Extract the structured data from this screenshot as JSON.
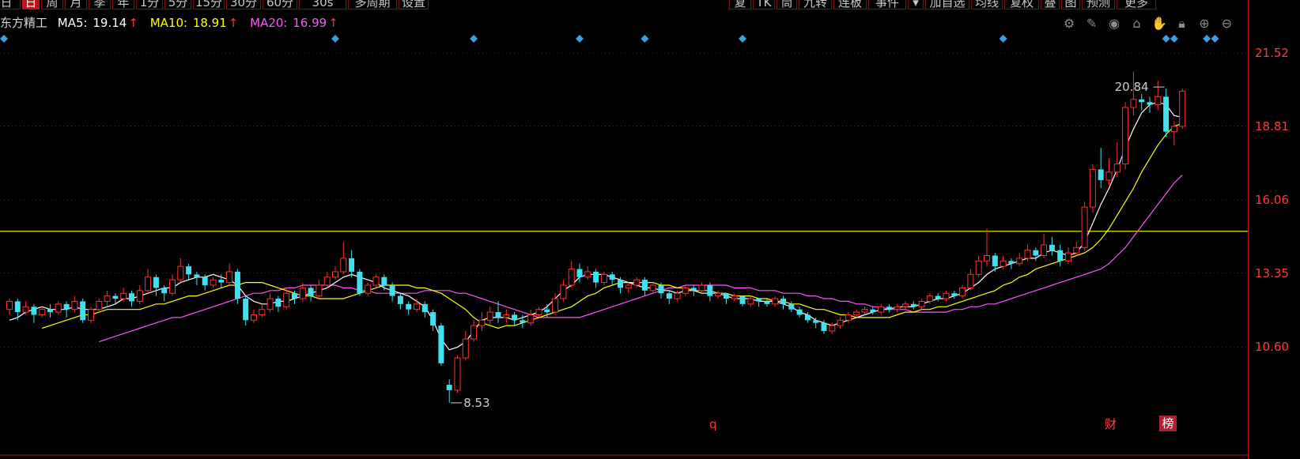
{
  "toolbar": {
    "left_items": [
      "日",
      "日",
      "周",
      "月",
      "季",
      "年",
      "1分",
      "5分",
      "15分",
      "30分",
      "60分",
      "30s",
      "多周期",
      "设置"
    ],
    "right_items": [
      "复",
      "TK",
      "筒",
      "九转",
      "连板",
      "事件",
      "加自选",
      "均线",
      "复权",
      "叠",
      "图",
      "预测",
      "更多"
    ]
  },
  "info": {
    "stock_name": "东方精工",
    "ma5": {
      "label": "MA5:",
      "value": "19.14",
      "arrow": "↑"
    },
    "ma10": {
      "label": "MA10:",
      "value": "18.91",
      "arrow": "↑"
    },
    "ma20": {
      "label": "MA20:",
      "value": "16.99",
      "arrow": "↑"
    }
  },
  "tool_icons": [
    "settings-icon",
    "pen-icon",
    "eye-icon",
    "bank-icon",
    "hand-icon",
    "lock-icon",
    "zoom-in-icon",
    "zoom-out-icon"
  ],
  "y_axis": {
    "labels": [
      "21.52",
      "18.81",
      "16.06",
      "13.35",
      "10.60"
    ]
  },
  "annotations": {
    "peak": {
      "text": "20.84",
      "value": 20.84
    },
    "low": {
      "text": "8.53",
      "value": 8.53
    },
    "bottom_marker": "q",
    "cai_marker": "财",
    "bang_marker": "榜"
  },
  "colors": {
    "up": "#ff3030",
    "down": "#40e0f0",
    "ma5": "#ffffff",
    "ma10": "#ffff00",
    "ma20": "#ff55ff",
    "hline": "#ffff00",
    "grid": "#7a1818",
    "event_diamond": "#3aa0e0"
  },
  "chart_data": {
    "type": "candlestick",
    "ylim": [
      8.0,
      22.2
    ],
    "horizontal_line": 14.9,
    "candles": [
      [
        12.0,
        12.3,
        11.8,
        12.4
      ],
      [
        12.3,
        11.9,
        11.6,
        12.4
      ],
      [
        11.9,
        12.1,
        11.8,
        12.3
      ],
      [
        12.1,
        11.8,
        11.5,
        12.2
      ],
      [
        11.8,
        12.0,
        11.7,
        12.1
      ],
      [
        12.0,
        11.9,
        11.7,
        12.2
      ],
      [
        11.9,
        12.2,
        11.8,
        12.3
      ],
      [
        12.2,
        12.0,
        11.7,
        12.3
      ],
      [
        12.0,
        12.3,
        11.9,
        12.5
      ],
      [
        12.3,
        11.6,
        11.5,
        12.4
      ],
      [
        11.6,
        12.0,
        11.5,
        12.1
      ],
      [
        12.0,
        12.3,
        11.9,
        12.4
      ],
      [
        12.3,
        12.5,
        12.1,
        12.7
      ],
      [
        12.5,
        12.4,
        12.2,
        12.6
      ],
      [
        12.4,
        12.6,
        12.3,
        12.8
      ],
      [
        12.6,
        12.3,
        12.1,
        12.7
      ],
      [
        12.3,
        12.7,
        12.2,
        12.9
      ],
      [
        12.7,
        13.2,
        12.6,
        13.5
      ],
      [
        13.2,
        12.8,
        12.5,
        13.3
      ],
      [
        12.8,
        12.6,
        12.3,
        12.9
      ],
      [
        12.6,
        13.1,
        12.5,
        13.3
      ],
      [
        13.1,
        13.6,
        13.0,
        13.9
      ],
      [
        13.6,
        13.3,
        13.1,
        13.7
      ],
      [
        13.3,
        13.2,
        12.9,
        13.4
      ],
      [
        13.2,
        12.9,
        12.7,
        13.3
      ],
      [
        12.9,
        13.1,
        12.8,
        13.2
      ],
      [
        13.1,
        13.0,
        12.8,
        13.3
      ],
      [
        13.0,
        13.4,
        12.9,
        13.7
      ],
      [
        13.4,
        12.4,
        12.2,
        13.5
      ],
      [
        12.4,
        11.6,
        11.4,
        12.5
      ],
      [
        11.6,
        11.8,
        11.5,
        12.0
      ],
      [
        11.8,
        12.0,
        11.7,
        12.2
      ],
      [
        12.0,
        12.4,
        11.9,
        12.6
      ],
      [
        12.4,
        12.1,
        11.9,
        12.5
      ],
      [
        12.1,
        12.6,
        12.0,
        12.8
      ],
      [
        12.6,
        12.4,
        12.2,
        12.7
      ],
      [
        12.4,
        12.8,
        12.3,
        13.0
      ],
      [
        12.8,
        12.5,
        12.3,
        12.9
      ],
      [
        12.5,
        12.9,
        12.4,
        13.1
      ],
      [
        12.9,
        13.2,
        12.8,
        13.4
      ],
      [
        13.2,
        13.4,
        13.1,
        13.6
      ],
      [
        13.4,
        13.9,
        13.3,
        14.5
      ],
      [
        13.9,
        13.4,
        13.2,
        14.2
      ],
      [
        13.4,
        12.6,
        12.5,
        13.5
      ],
      [
        12.6,
        12.9,
        12.5,
        13.0
      ],
      [
        12.9,
        13.2,
        12.8,
        13.3
      ],
      [
        13.2,
        12.9,
        12.7,
        13.3
      ],
      [
        12.9,
        12.5,
        12.3,
        13.0
      ],
      [
        12.5,
        12.2,
        12.0,
        12.6
      ],
      [
        12.2,
        12.0,
        11.8,
        12.3
      ],
      [
        12.0,
        12.2,
        11.9,
        12.4
      ],
      [
        12.2,
        11.9,
        11.7,
        12.3
      ],
      [
        11.9,
        11.4,
        11.2,
        12.0
      ],
      [
        11.4,
        10.0,
        9.9,
        11.5
      ],
      [
        9.2,
        9.0,
        8.53,
        9.4
      ],
      [
        9.0,
        10.2,
        8.9,
        10.3
      ],
      [
        10.2,
        10.9,
        10.1,
        11.2
      ],
      [
        10.9,
        11.4,
        10.8,
        11.6
      ],
      [
        11.4,
        11.6,
        11.2,
        11.9
      ],
      [
        11.6,
        11.9,
        11.4,
        12.1
      ],
      [
        11.9,
        11.7,
        11.5,
        12.3
      ],
      [
        11.7,
        11.8,
        11.5,
        12.0
      ],
      [
        11.8,
        11.6,
        11.4,
        11.9
      ],
      [
        11.6,
        11.5,
        11.3,
        11.8
      ],
      [
        11.5,
        11.8,
        11.4,
        12.0
      ],
      [
        11.8,
        12.0,
        11.7,
        12.1
      ],
      [
        12.0,
        11.9,
        11.7,
        12.2
      ],
      [
        11.9,
        12.4,
        11.8,
        12.6
      ],
      [
        12.4,
        12.9,
        12.3,
        13.1
      ],
      [
        12.9,
        13.5,
        12.8,
        13.8
      ],
      [
        13.5,
        13.2,
        13.0,
        13.7
      ],
      [
        13.2,
        13.4,
        13.1,
        13.6
      ],
      [
        13.4,
        13.0,
        12.8,
        13.5
      ],
      [
        13.0,
        13.3,
        12.9,
        13.4
      ],
      [
        13.3,
        13.1,
        12.9,
        13.4
      ],
      [
        13.1,
        12.8,
        12.6,
        13.2
      ],
      [
        12.8,
        12.9,
        12.6,
        13.0
      ],
      [
        12.9,
        13.1,
        12.8,
        13.2
      ],
      [
        13.1,
        12.7,
        12.5,
        13.2
      ],
      [
        12.7,
        12.9,
        12.6,
        13.0
      ],
      [
        12.9,
        12.6,
        12.4,
        13.0
      ],
      [
        12.6,
        12.4,
        12.2,
        12.7
      ],
      [
        12.4,
        12.6,
        12.3,
        12.7
      ],
      [
        12.6,
        12.8,
        12.5,
        12.9
      ],
      [
        12.8,
        12.7,
        12.5,
        12.9
      ],
      [
        12.7,
        12.9,
        12.6,
        13.0
      ],
      [
        12.9,
        12.5,
        12.3,
        13.0
      ],
      [
        12.5,
        12.6,
        12.4,
        12.7
      ],
      [
        12.6,
        12.4,
        12.2,
        12.6
      ],
      [
        12.4,
        12.5,
        12.3,
        12.6
      ],
      [
        12.5,
        12.2,
        12.1,
        12.5
      ],
      [
        12.2,
        12.4,
        12.1,
        12.5
      ],
      [
        12.4,
        12.3,
        12.1,
        12.4
      ],
      [
        12.3,
        12.2,
        12.1,
        12.4
      ],
      [
        12.2,
        12.4,
        12.1,
        12.5
      ],
      [
        12.4,
        12.2,
        12.0,
        12.5
      ],
      [
        12.2,
        12.0,
        11.9,
        12.3
      ],
      [
        12.0,
        11.8,
        11.7,
        12.1
      ],
      [
        11.8,
        11.6,
        11.5,
        11.9
      ],
      [
        11.6,
        11.5,
        11.3,
        11.7
      ],
      [
        11.5,
        11.2,
        11.1,
        11.6
      ],
      [
        11.2,
        11.4,
        11.1,
        11.5
      ],
      [
        11.4,
        11.6,
        11.3,
        11.7
      ],
      [
        11.6,
        11.8,
        11.5,
        11.9
      ],
      [
        11.8,
        11.9,
        11.7,
        12.0
      ],
      [
        11.9,
        12.0,
        11.8,
        12.1
      ],
      [
        12.0,
        11.9,
        11.8,
        12.1
      ],
      [
        11.9,
        12.1,
        11.8,
        12.2
      ],
      [
        12.1,
        12.0,
        11.9,
        12.2
      ],
      [
        12.0,
        12.1,
        11.9,
        12.2
      ],
      [
        12.1,
        12.2,
        12.0,
        12.3
      ],
      [
        12.2,
        12.1,
        12.0,
        12.3
      ],
      [
        12.1,
        12.3,
        12.0,
        12.4
      ],
      [
        12.3,
        12.5,
        12.2,
        12.6
      ],
      [
        12.5,
        12.4,
        12.3,
        12.6
      ],
      [
        12.4,
        12.6,
        12.3,
        12.7
      ],
      [
        12.6,
        12.5,
        12.4,
        12.7
      ],
      [
        12.5,
        12.8,
        12.4,
        12.9
      ],
      [
        12.8,
        13.3,
        12.7,
        13.5
      ],
      [
        13.3,
        13.8,
        13.2,
        14.0
      ],
      [
        13.8,
        14.0,
        13.6,
        15.0
      ],
      [
        14.0,
        13.6,
        13.4,
        14.1
      ],
      [
        13.6,
        13.8,
        13.5,
        14.0
      ],
      [
        13.8,
        13.7,
        13.5,
        13.9
      ],
      [
        13.7,
        13.9,
        13.6,
        14.1
      ],
      [
        13.9,
        14.2,
        13.8,
        14.4
      ],
      [
        14.2,
        14.0,
        13.8,
        14.3
      ],
      [
        14.0,
        14.4,
        13.9,
        14.8
      ],
      [
        14.4,
        14.2,
        14.0,
        14.7
      ],
      [
        14.2,
        13.8,
        13.6,
        14.4
      ],
      [
        13.8,
        14.1,
        13.7,
        14.3
      ],
      [
        14.1,
        14.3,
        14.0,
        14.5
      ],
      [
        14.3,
        15.8,
        14.2,
        16.0
      ],
      [
        15.8,
        17.2,
        15.6,
        17.4
      ],
      [
        17.2,
        16.8,
        16.5,
        18.0
      ],
      [
        16.8,
        17.1,
        16.6,
        17.6
      ],
      [
        17.1,
        17.4,
        16.9,
        18.2
      ],
      [
        17.4,
        19.5,
        17.2,
        19.7
      ],
      [
        19.5,
        19.8,
        19.2,
        20.84
      ],
      [
        19.8,
        19.7,
        19.4,
        20.0
      ],
      [
        19.7,
        19.6,
        19.3,
        19.9
      ],
      [
        19.6,
        19.9,
        19.4,
        20.5
      ],
      [
        19.9,
        18.6,
        18.4,
        20.2
      ],
      [
        18.6,
        18.8,
        18.1,
        19.0
      ],
      [
        18.8,
        20.1,
        18.7,
        20.2
      ]
    ],
    "ma5": [
      11.6,
      11.7,
      11.9,
      12.0,
      12.1,
      12.0,
      12.0,
      12.0,
      12.1,
      12.0,
      12.0,
      12.0,
      12.1,
      12.2,
      12.4,
      12.4,
      12.5,
      12.6,
      12.7,
      12.8,
      12.8,
      13.0,
      13.1,
      13.2,
      13.2,
      13.3,
      13.2,
      13.1,
      12.9,
      12.5,
      12.3,
      12.2,
      12.2,
      12.3,
      12.3,
      12.4,
      12.5,
      12.6,
      12.7,
      12.8,
      13.0,
      13.2,
      13.3,
      13.2,
      13.1,
      13.0,
      12.8,
      12.7,
      12.6,
      12.5,
      12.3,
      12.1,
      11.6,
      10.9,
      10.5,
      10.6,
      10.8,
      11.2,
      11.6,
      11.7,
      11.7,
      11.7,
      11.6,
      11.7,
      11.8,
      11.9,
      12.1,
      12.4,
      12.7,
      12.9,
      13.2,
      13.3,
      13.3,
      13.3,
      13.2,
      13.1,
      13.0,
      12.9,
      12.8,
      12.8,
      12.7,
      12.7,
      12.6,
      12.7,
      12.7,
      12.6,
      12.6,
      12.6,
      12.5,
      12.4,
      12.4,
      12.4,
      12.3,
      12.3,
      12.3,
      12.2,
      12.1,
      11.9,
      11.8,
      11.6,
      11.5,
      11.4,
      11.5,
      11.6,
      11.7,
      11.8,
      11.9,
      12.0,
      12.0,
      12.1,
      12.1,
      12.1,
      12.2,
      12.3,
      12.4,
      12.4,
      12.5,
      12.6,
      12.8,
      13.0,
      13.3,
      13.5,
      13.6,
      13.7,
      13.8,
      13.9,
      13.9,
      14.1,
      14.2,
      14.1,
      14.0,
      14.1,
      14.5,
      15.2,
      15.9,
      16.5,
      17.2,
      18.0,
      18.7,
      19.3,
      19.6,
      19.7,
      19.6,
      19.2,
      19.14
    ],
    "ma10": [
      11.3,
      11.4,
      11.5,
      11.6,
      11.7,
      11.8,
      11.8,
      11.9,
      12.0,
      12.0,
      12.0,
      12.0,
      12.0,
      12.1,
      12.2,
      12.2,
      12.3,
      12.4,
      12.5,
      12.5,
      12.6,
      12.7,
      12.8,
      12.9,
      12.9,
      13.0,
      13.0,
      13.0,
      12.9,
      12.8,
      12.7,
      12.6,
      12.5,
      12.5,
      12.4,
      12.4,
      12.4,
      12.4,
      12.5,
      12.6,
      12.7,
      12.8,
      12.9,
      12.9,
      12.9,
      12.9,
      12.8,
      12.8,
      12.7,
      12.6,
      12.4,
      12.2,
      12.0,
      11.7,
      11.5,
      11.4,
      11.3,
      11.4,
      11.4,
      11.5,
      11.6,
      11.7,
      11.8,
      11.9,
      12.0,
      12.1,
      12.3,
      12.5,
      12.6,
      12.8,
      12.9,
      13.0,
      13.0,
      13.0,
      13.0,
      13.0,
      12.9,
      12.9,
      12.8,
      12.8,
      12.7,
      12.7,
      12.7,
      12.6,
      12.6,
      12.5,
      12.5,
      12.5,
      12.4,
      12.4,
      12.3,
      12.3,
      12.2,
      12.2,
      12.1,
      12.0,
      12.0,
      11.9,
      11.8,
      11.8,
      11.7,
      11.7,
      11.7,
      11.7,
      11.7,
      11.8,
      11.9,
      11.9,
      12.0,
      12.0,
      12.1,
      12.1,
      12.2,
      12.3,
      12.4,
      12.5,
      12.6,
      12.7,
      12.9,
      13.0,
      13.2,
      13.3,
      13.5,
      13.6,
      13.7,
      13.8,
      13.9,
      14.0,
      14.1,
      14.3,
      14.6,
      15.0,
      15.5,
      16.0,
      16.5,
      17.1,
      17.6,
      18.1,
      18.5,
      18.8,
      18.91
    ],
    "ma20": [
      10.8,
      10.9,
      11.0,
      11.1,
      11.2,
      11.3,
      11.4,
      11.5,
      11.6,
      11.7,
      11.7,
      11.8,
      11.9,
      12.0,
      12.1,
      12.2,
      12.3,
      12.4,
      12.5,
      12.6,
      12.6,
      12.7,
      12.7,
      12.8,
      12.8,
      12.9,
      12.9,
      12.9,
      12.9,
      12.9,
      12.8,
      12.8,
      12.7,
      12.7,
      12.6,
      12.6,
      12.6,
      12.6,
      12.6,
      12.6,
      12.7,
      12.7,
      12.7,
      12.7,
      12.6,
      12.6,
      12.5,
      12.4,
      12.3,
      12.2,
      12.1,
      12.0,
      11.9,
      11.8,
      11.7,
      11.7,
      11.7,
      11.7,
      11.7,
      11.7,
      11.8,
      11.9,
      12.0,
      12.1,
      12.2,
      12.3,
      12.4,
      12.5,
      12.6,
      12.7,
      12.8,
      12.8,
      12.9,
      12.9,
      12.9,
      12.9,
      12.9,
      12.9,
      12.8,
      12.8,
      12.8,
      12.7,
      12.7,
      12.7,
      12.6,
      12.6,
      12.6,
      12.5,
      12.5,
      12.4,
      12.4,
      12.3,
      12.3,
      12.2,
      12.2,
      12.1,
      12.1,
      12.0,
      12.0,
      12.0,
      11.9,
      11.9,
      11.9,
      11.9,
      11.9,
      12.0,
      12.0,
      12.1,
      12.1,
      12.2,
      12.2,
      12.3,
      12.4,
      12.5,
      12.6,
      12.7,
      12.8,
      12.9,
      13.0,
      13.1,
      13.2,
      13.3,
      13.4,
      13.5,
      13.7,
      14.0,
      14.3,
      14.7,
      15.1,
      15.5,
      15.9,
      16.3,
      16.7,
      16.99
    ],
    "event_diamonds_at": [
      0,
      40,
      57,
      70,
      78,
      90,
      122,
      142,
      143,
      147,
      148,
      155
    ],
    "peak_index": 142,
    "low_index": 54
  }
}
